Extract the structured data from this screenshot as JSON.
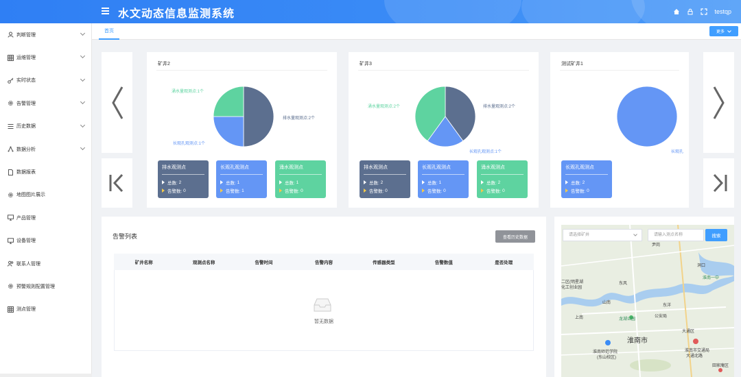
{
  "header": {
    "title": "水文动态信息监测系统",
    "username": "testqp",
    "icons": [
      "home-icon",
      "lock-icon",
      "fullscreen-icon"
    ]
  },
  "sidebar": {
    "items": [
      {
        "label": "判断管理",
        "icon": "user-icon",
        "expandable": true
      },
      {
        "label": "运维管理",
        "icon": "grid-icon",
        "expandable": true
      },
      {
        "label": "实时状态",
        "icon": "key-icon",
        "expandable": true
      },
      {
        "label": "告警管理",
        "icon": "gear-icon",
        "expandable": true
      },
      {
        "label": "历史数据",
        "icon": "list-icon",
        "expandable": true
      },
      {
        "label": "数据分析",
        "icon": "nodes-icon",
        "expandable": true
      },
      {
        "label": "数据报表",
        "icon": "document-icon",
        "expandable": false
      },
      {
        "label": "地图图片展示",
        "icon": "gear-icon",
        "expandable": false
      },
      {
        "label": "产品管理",
        "icon": "monitor-icon",
        "expandable": false
      },
      {
        "label": "设备管理",
        "icon": "monitor-icon",
        "expandable": false
      },
      {
        "label": "联系人管理",
        "icon": "users-icon",
        "expandable": false
      },
      {
        "label": "预警规则配置管理",
        "icon": "gear-icon",
        "expandable": false
      },
      {
        "label": "测点管理",
        "icon": "grid-icon",
        "expandable": false
      }
    ]
  },
  "tabs": {
    "home": "首页",
    "more": "更多"
  },
  "mines": [
    {
      "title": "矿井2",
      "labels": {
        "water": "涌水量观测点:1个",
        "drain": "排水量观测点:2个",
        "hole": "长观孔观测点:1个"
      },
      "stats": [
        {
          "title": "排水观测点",
          "total_label": "总数:",
          "total": "2",
          "alarm_label": "告警数:",
          "alarm": "0"
        },
        {
          "title": "长观孔观测点",
          "total_label": "总数:",
          "total": "1",
          "alarm_label": "告警数:",
          "alarm": "1"
        },
        {
          "title": "涌水观测点",
          "total_label": "总数:",
          "total": "1",
          "alarm_label": "告警数:",
          "alarm": "0"
        }
      ]
    },
    {
      "title": "矿井3",
      "labels": {
        "water": "涌水量观测点:2个",
        "drain": "排水量观测点:2个",
        "hole": "长观孔观测点:1个"
      },
      "stats": [
        {
          "title": "排水观测点",
          "total_label": "总数:",
          "total": "2",
          "alarm_label": "告警数:",
          "alarm": "0"
        },
        {
          "title": "长观孔观测点",
          "total_label": "总数:",
          "total": "1",
          "alarm_label": "告警数:",
          "alarm": "0"
        },
        {
          "title": "涌水观测点",
          "total_label": "总数:",
          "total": "2",
          "alarm_label": "告警数:",
          "alarm": "0"
        }
      ]
    },
    {
      "title": "测试矿井1",
      "labels": {
        "hole": "长观孔"
      },
      "stats": [
        {
          "title": "长观孔观测点",
          "total_label": "总数:",
          "total": "2",
          "alarm_label": "告警数:",
          "alarm": "0"
        }
      ]
    }
  ],
  "chart_data": [
    {
      "type": "pie",
      "title": "矿井2",
      "series": [
        {
          "values": [
            {
              "label": "排水量观测点",
              "value": 2
            },
            {
              "label": "长观孔观测点",
              "value": 1
            },
            {
              "label": "涌水量观测点",
              "value": 1
            }
          ]
        }
      ]
    },
    {
      "type": "pie",
      "title": "矿井3",
      "series": [
        {
          "values": [
            {
              "label": "排水量观测点",
              "value": 2
            },
            {
              "label": "长观孔观测点",
              "value": 1
            },
            {
              "label": "涌水量观测点",
              "value": 2
            }
          ]
        }
      ]
    },
    {
      "type": "pie",
      "title": "测试矿井1",
      "series": [
        {
          "values": [
            {
              "label": "长观孔观测点",
              "value": 2
            }
          ]
        }
      ]
    }
  ],
  "colors": {
    "drain": "#5c6f8f",
    "hole": "#6496f5",
    "water": "#5ed3a0",
    "primary": "#409eff"
  },
  "alarm": {
    "title": "告警列表",
    "history_btn": "查看历史数据",
    "columns": [
      "矿井名称",
      "观测点名称",
      "告警时间",
      "告警内容",
      "传感器类型",
      "告警数值",
      "是否处理"
    ],
    "empty": "暂无数据"
  },
  "map": {
    "select_placeholder": "请选择矿井",
    "input_placeholder": "请输入测点名称",
    "search_btn": "搜索",
    "city": "淮南市",
    "labels": [
      "尹岗",
      "洞口",
      "二区(明星湖",
      "化工创业园",
      "东风",
      "山南",
      "东洋",
      "上南",
      "公安局",
      "龙湖公园",
      "大通区",
      "淮南师范学院",
      "(东山校区)",
      "淮南市交通局",
      "大通北路",
      "淮南一中",
      "田家庵区"
    ]
  }
}
